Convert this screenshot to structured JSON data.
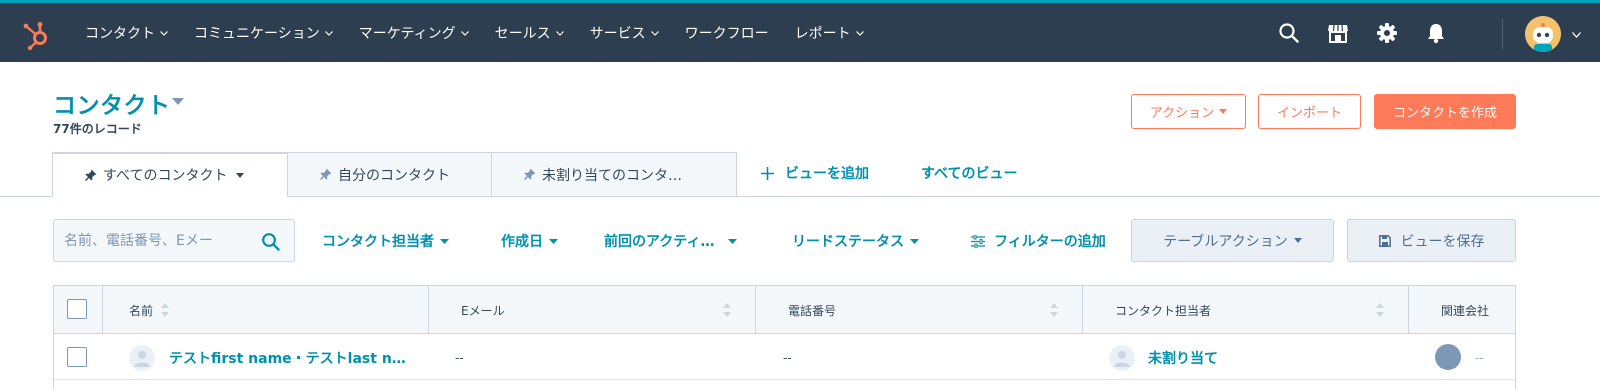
{
  "nav": {
    "items": [
      {
        "label": "コンタクト"
      },
      {
        "label": "コミュニケーション"
      },
      {
        "label": "マーケティング"
      },
      {
        "label": "セールス"
      },
      {
        "label": "サービス"
      },
      {
        "label": "ワークフロー"
      },
      {
        "label": "レポート"
      }
    ],
    "icons": [
      "search-icon",
      "marketplace-icon",
      "gear-icon",
      "bell-icon"
    ],
    "colors": {
      "bar": "#2d3e50",
      "accent": "#00a4bd",
      "logo": "#ff7a59"
    }
  },
  "header": {
    "title": "コンタクト",
    "record_count": "77件のレコード",
    "actions_label": "アクション",
    "import_label": "インポート",
    "create_label": "コンタクトを作成"
  },
  "tabs": {
    "items": [
      {
        "label": "すべてのコンタクト"
      },
      {
        "label": "自分のコンタクト"
      },
      {
        "label": "未割り当てのコンタ…"
      }
    ],
    "add_view": "ビューを追加",
    "all_views": "すべてのビュー"
  },
  "filters": {
    "search_placeholder": "名前、電話番号、Eメー",
    "owner": "コンタクト担当者",
    "created": "作成日",
    "last_activity": "前回のアクティ…",
    "lead_status": "リードステータス",
    "add_filter": "フィルターの追加",
    "table_actions": "テーブルアクション",
    "save_view": "ビューを保存"
  },
  "table": {
    "columns": [
      "名前",
      "Eメール",
      "電話番号",
      "コンタクト担当者",
      "関連会社"
    ],
    "rows": [
      {
        "name": "テストfirst name・テストlast n…",
        "email": "--",
        "phone": "--",
        "owner": "未割り当て",
        "company": "--"
      }
    ]
  }
}
